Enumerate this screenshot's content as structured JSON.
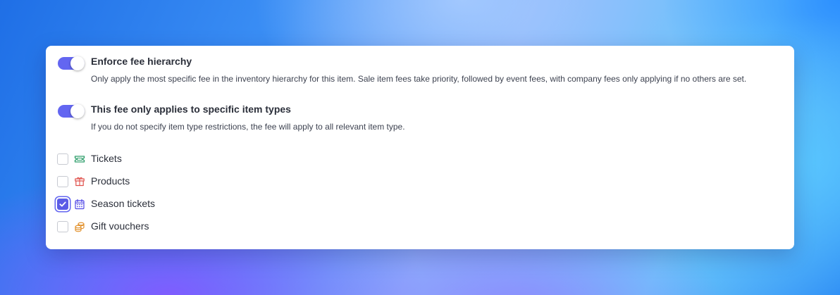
{
  "settings": [
    {
      "title": "Enforce fee hierarchy",
      "description": "Only apply the most specific fee in the inventory hierarchy for this item. Sale item fees take priority, followed by event fees, with company fees only applying if no others are set.",
      "enabled": true
    },
    {
      "title": "This fee only applies to specific item types",
      "description": "If you do not specify item type restrictions, the fee will apply to all relevant item type.",
      "enabled": true
    }
  ],
  "item_types": [
    {
      "label": "Tickets",
      "checked": false,
      "icon": "ticket-icon",
      "icon_color": "#2e9e6b"
    },
    {
      "label": "Products",
      "checked": false,
      "icon": "gift-box-icon",
      "icon_color": "#e0524c"
    },
    {
      "label": "Season tickets",
      "checked": true,
      "icon": "calendar-icon",
      "icon_color": "#4f46e5"
    },
    {
      "label": "Gift vouchers",
      "checked": false,
      "icon": "coins-icon",
      "icon_color": "#e08a1e"
    }
  ],
  "colors": {
    "accent": "#6366f1",
    "checkbox_checked": "#5b5ce6"
  }
}
